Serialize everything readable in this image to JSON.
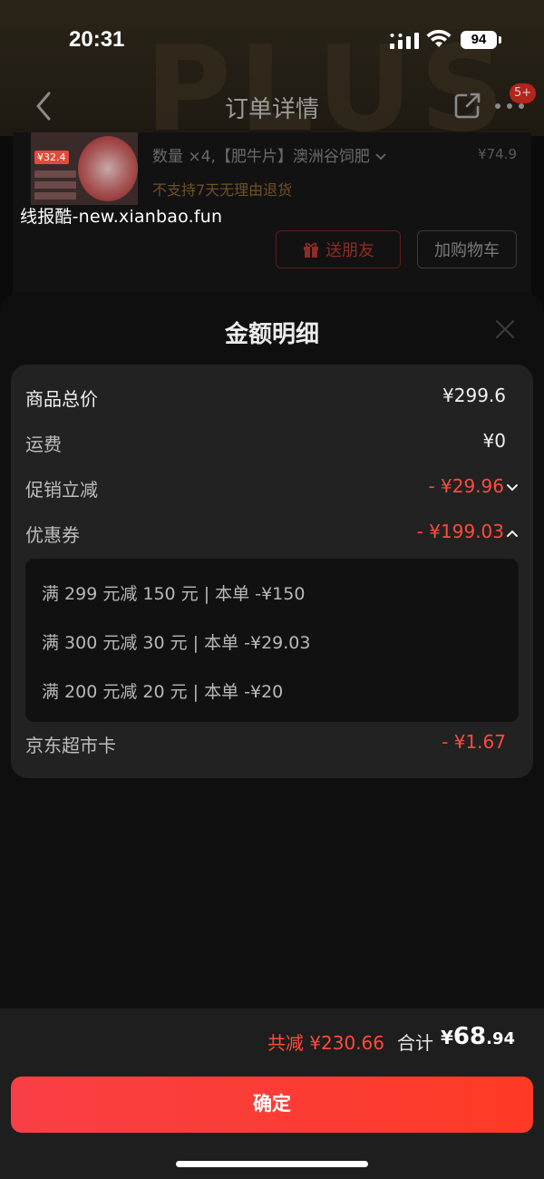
{
  "status_bar": {
    "time": "20:31",
    "battery": "94"
  },
  "nav": {
    "title": "订单详情",
    "badge": "5+",
    "watermark_logo": "PLUS"
  },
  "order_item": {
    "thumb_price": "¥32.4",
    "description": "数量 ×4,【肥牛片】澳洲谷饲肥",
    "price": "¥74.9",
    "return_note": "不支持7天无理由退货",
    "gift_button": "送朋友",
    "cart_button": "加购物车"
  },
  "watermark": "线报酷-new.xianbao.fun",
  "sheet": {
    "title": "金额明细",
    "rows": [
      {
        "label": "商品总价",
        "value": "¥299.6"
      },
      {
        "label": "运费",
        "value": "¥0"
      },
      {
        "label": "促销立减",
        "value": "- ¥29.96"
      },
      {
        "label": "优惠券",
        "value": "- ¥199.03"
      }
    ],
    "coupons": [
      "满 299 元减 150 元 | 本单 -¥150",
      "满 300 元减 30 元 | 本单 -¥29.03",
      "满 200 元减 20 元 | 本单 -¥20"
    ],
    "card_row": {
      "label": "京东超市卡",
      "value": "- ¥1.67"
    }
  },
  "footer": {
    "saving": "共减 ¥230.66",
    "total_label": "合计",
    "total_symbol": "¥",
    "total_int": "68",
    "total_dec": ".94",
    "confirm": "确定"
  },
  "colors": {
    "accent_red": "#ff4a3b",
    "button_start": "#f93f46",
    "button_end": "#fe3a25"
  },
  "icons": [
    "back-icon",
    "share-icon",
    "more-icon",
    "gift-icon",
    "chevron-down-icon",
    "chevron-up-icon",
    "close-icon",
    "signal-icon",
    "wifi-icon"
  ]
}
